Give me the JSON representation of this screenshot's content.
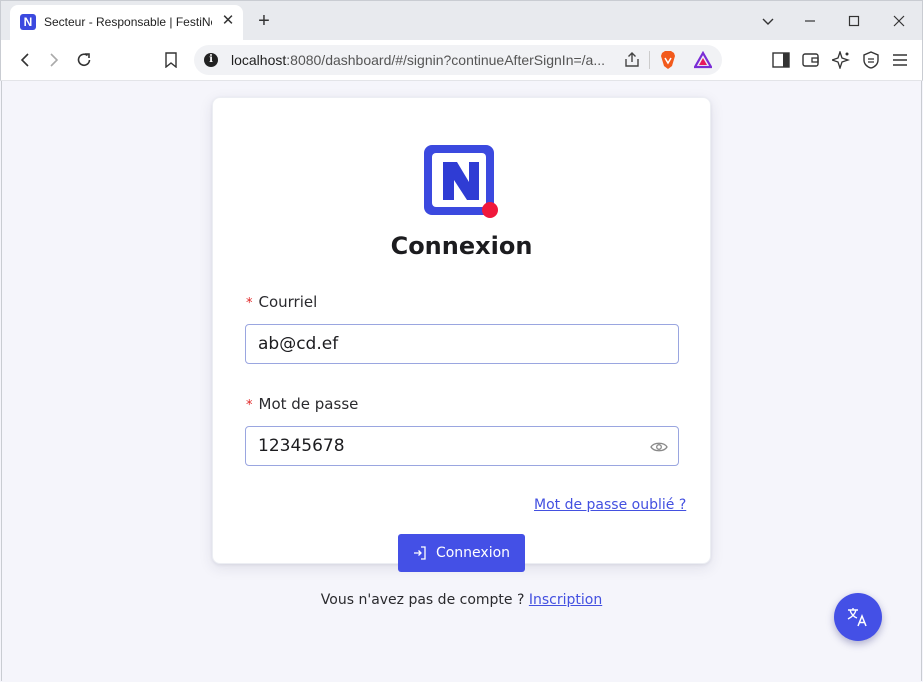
{
  "browser": {
    "tab_title": "Secteur - Responsable | FestiNe",
    "favicon_letter": "N",
    "url_host": "localhost",
    "url_rest": ":8080/dashboard/#/signin?continueAfterSignIn=/a..."
  },
  "login": {
    "title": "Connexion",
    "email_label": "Courriel",
    "email_value": "ab@cd.ef",
    "password_label": "Mot de passe",
    "password_value": "12345678",
    "required_marker": "*",
    "forgot_link": "Mot de passe oublié ?",
    "submit_label": "Connexion",
    "no_account_text": "Vous n'avez pas de compte ? ",
    "signup_link": "Inscription"
  },
  "colors": {
    "brand": "#4450e6",
    "logo_dot": "#f0183c",
    "required": "#e02424"
  },
  "icons": {
    "fab": "translate-icon",
    "password_toggle": "eye-icon",
    "submit": "sign-in-icon"
  }
}
